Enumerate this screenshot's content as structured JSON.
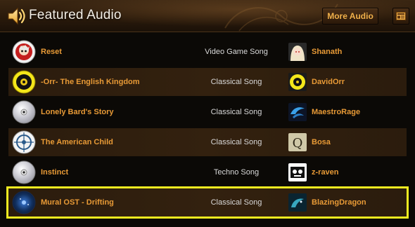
{
  "header": {
    "title": "Featured Audio",
    "more_label": "More Audio"
  },
  "rows": [
    {
      "song": "Reset",
      "genre": "Video Game Song",
      "user": "Shanath"
    },
    {
      "song": "-Orr- The English Kingdom",
      "genre": "Classical Song",
      "user": "DavidOrr"
    },
    {
      "song": "Lonely Bard's Story",
      "genre": "Classical Song",
      "user": "MaestroRage"
    },
    {
      "song": "The American Child",
      "genre": "Classical Song",
      "user": "Bosa"
    },
    {
      "song": "Instinct",
      "genre": "Techno Song",
      "user": "z-raven"
    },
    {
      "song": "Mural OST - Drifting",
      "genre": "Classical Song",
      "user": "BlazingDragon"
    }
  ],
  "colors": {
    "link": "#e89a36",
    "highlight": "#f0ea20",
    "title": "#f4efe6"
  },
  "icons": {
    "header": "speaker-icon",
    "feed": "feed-icon"
  }
}
